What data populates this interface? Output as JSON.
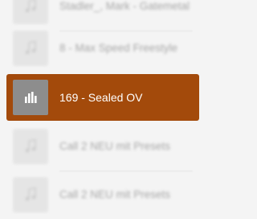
{
  "list": {
    "items": [
      {
        "label": "Stadler_, Mark - Gatemetal",
        "icon": "music-note-icon",
        "selected": false
      },
      {
        "label": "8 - Max Speed Freestyle",
        "icon": "music-note-icon",
        "selected": false
      },
      {
        "label": "169 - Sealed OV",
        "icon": "bar-chart-icon",
        "selected": true
      },
      {
        "label": "Call 2 NEU mit Presets",
        "icon": "music-note-icon",
        "selected": false
      },
      {
        "label": "Call 2 NEU mit Presets",
        "icon": "music-note-icon",
        "selected": false
      }
    ]
  },
  "colors": {
    "selected_bg": "#a34a0b",
    "thumb": "#e3e3e3",
    "selected_thumb": "#8d8d8d"
  }
}
